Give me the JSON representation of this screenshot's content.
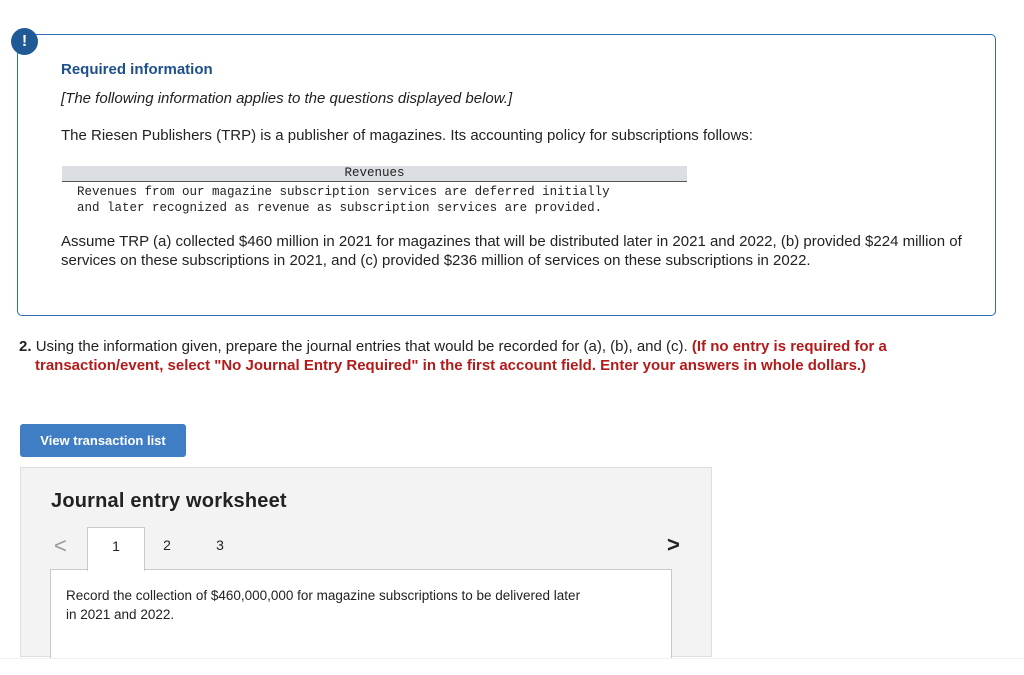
{
  "alert_symbol": "!",
  "info": {
    "title": "Required information",
    "italic_note": "[The following information applies to the questions displayed below.]",
    "intro": "The Riesen Publishers (TRP) is a publisher of magazines. Its accounting policy for subscriptions follows:",
    "policy": {
      "header": "Revenues",
      "body": "Revenues from our magazine subscription services are deferred initially\nand later recognized as revenue as subscription services are provided."
    },
    "assume": "Assume TRP (a) collected $460 million in 2021 for magazines that will be distributed later in 2021 and 2022, (b) provided $224 million of services on these subscriptions in 2021, and (c) provided $236 million of services on these subscriptions in 2022."
  },
  "question": {
    "number": "2.",
    "text": "Using the information given, prepare the journal entries that would be recorded for (a), (b), and (c).",
    "instruction_line1": "(If no entry is required for a",
    "instruction_line2": "transaction/event, select \"No Journal Entry Required\" in the first account field. Enter your answers in whole dollars.)"
  },
  "view_button_label": "View transaction list",
  "worksheet": {
    "title": "Journal entry worksheet",
    "prev_icon": "<",
    "next_icon": ">",
    "tabs": [
      "1",
      "2",
      "3"
    ],
    "active_tab": "1",
    "description": "Record the collection of $460,000,000 for magazine subscriptions to be delivered later in 2021 and 2022."
  },
  "colors": {
    "accent_blue": "#2c6cb0",
    "title_blue": "#1d4f8a",
    "button_blue": "#3f7ec5",
    "instruction_red": "#b31b1b"
  }
}
